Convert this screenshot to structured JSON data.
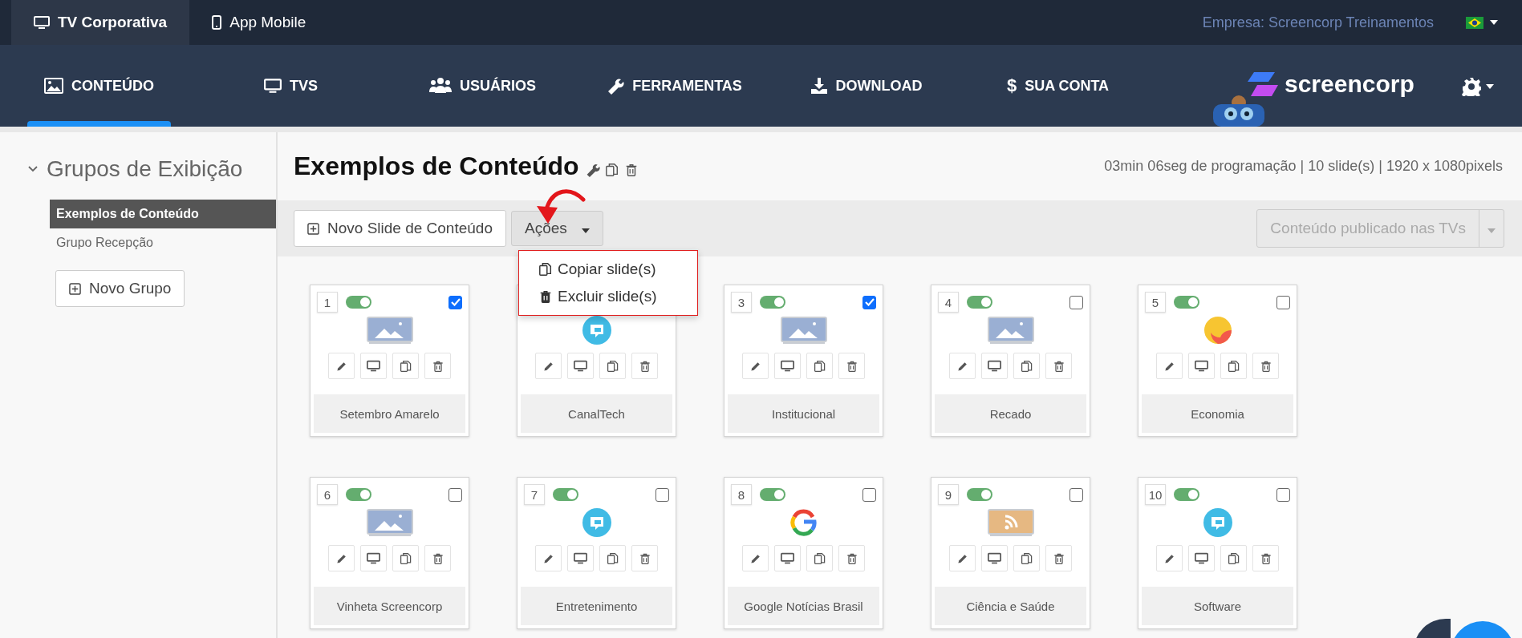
{
  "top_bar": {
    "tabs": [
      {
        "label": "TV Corporativa",
        "selected": true
      },
      {
        "label": "App Mobile",
        "selected": false
      }
    ],
    "company": "Empresa: Screencorp Treinamentos"
  },
  "nav": {
    "items": [
      {
        "label": "CONTEÚDO",
        "selected": true
      },
      {
        "label": "TVS",
        "selected": false
      },
      {
        "label": "USUÁRIOS",
        "selected": false
      },
      {
        "label": "FERRAMENTAS",
        "selected": false
      },
      {
        "label": "DOWNLOAD",
        "selected": false
      },
      {
        "label": "$",
        "label_2": "SUA CONTA",
        "selected": false
      }
    ],
    "logo": "screencorp"
  },
  "sidebar": {
    "title": "Grupos de Exibição",
    "expanded": true,
    "items": [
      {
        "label": "Exemplos de Conteúdo",
        "selected": true
      },
      {
        "label": "Grupo Recepção",
        "selected": false
      }
    ],
    "new_group_button": "Novo Grupo"
  },
  "main": {
    "title": "Exemplos de Conteúdo",
    "info": "03min 06seg de programação | 10 slide(s) | 1920 x 1080pixels",
    "new_slide_button": "Novo Slide de Conteúdo",
    "actions_button": "Ações",
    "actions_menu": [
      "Copiar slide(s)",
      "Excluir slide(s)"
    ],
    "publish_button": {
      "label": "Conteúdo publicado nas TVs",
      "disabled": true
    }
  },
  "slides": [
    {
      "number": "1",
      "on": true,
      "checked": true,
      "kind": "image",
      "name": "Setembro Amarelo"
    },
    {
      "kind": "channel",
      "name": "CanalTech"
    },
    {
      "number": "3",
      "on": true,
      "checked": true,
      "kind": "image",
      "name": "Institucional"
    },
    {
      "number": "4",
      "on": true,
      "checked": false,
      "kind": "image",
      "name": "Recado"
    },
    {
      "number": "5",
      "on": true,
      "checked": false,
      "kind": "sun",
      "name": "Economia"
    },
    {
      "number": "6",
      "on": true,
      "checked": false,
      "kind": "image",
      "name": "Vinheta Screencorp"
    },
    {
      "number": "7",
      "on": true,
      "checked": false,
      "kind": "channel",
      "name": "Entretenimento"
    },
    {
      "number": "8",
      "on": true,
      "checked": false,
      "kind": "google",
      "name": "Google Notícias Brasil"
    },
    {
      "number": "9",
      "on": true,
      "checked": false,
      "kind": "rss",
      "name": "Ciência e Saúde"
    },
    {
      "number": "10",
      "on": true,
      "checked": false,
      "kind": "channel",
      "name": "Software"
    }
  ]
}
